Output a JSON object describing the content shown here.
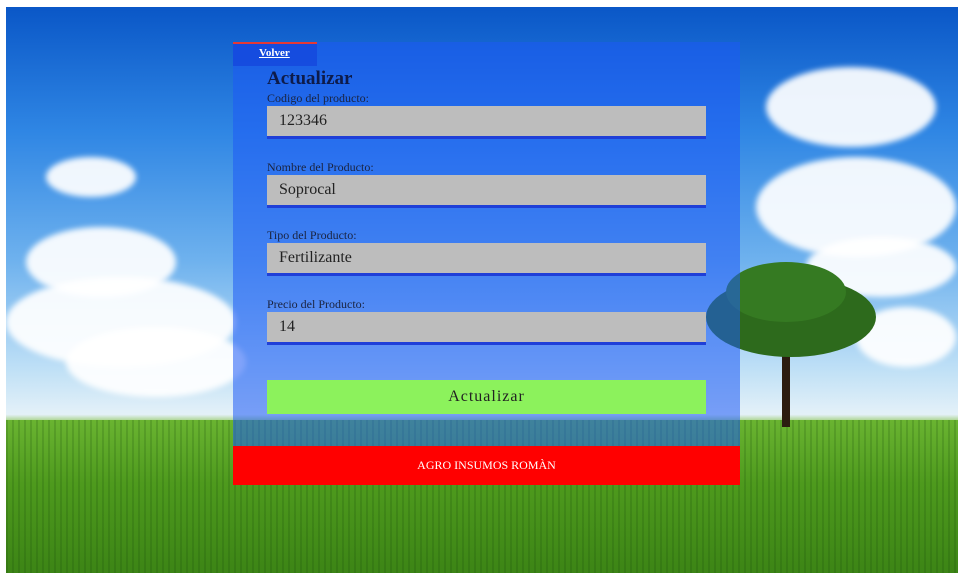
{
  "nav": {
    "back_label": "Volver"
  },
  "form": {
    "title": "Actualizar",
    "fields": [
      {
        "label": "Codigo del producto:",
        "value": "123346"
      },
      {
        "label": "Nombre del Producto:",
        "value": "Soprocal"
      },
      {
        "label": "Tipo del Producto:",
        "value": "Fertilizante"
      },
      {
        "label": "Precio del Producto:",
        "value": "14"
      }
    ],
    "submit_label": "Actualizar"
  },
  "footer": {
    "text": "AGRO INSUMOS ROMÀN"
  },
  "colors": {
    "panel": "#1e5af5",
    "input_bg": "#bdbdbd",
    "input_underline": "#1f3fd8",
    "submit_bg": "#8cf25c",
    "footer_bg": "#ff0000"
  }
}
